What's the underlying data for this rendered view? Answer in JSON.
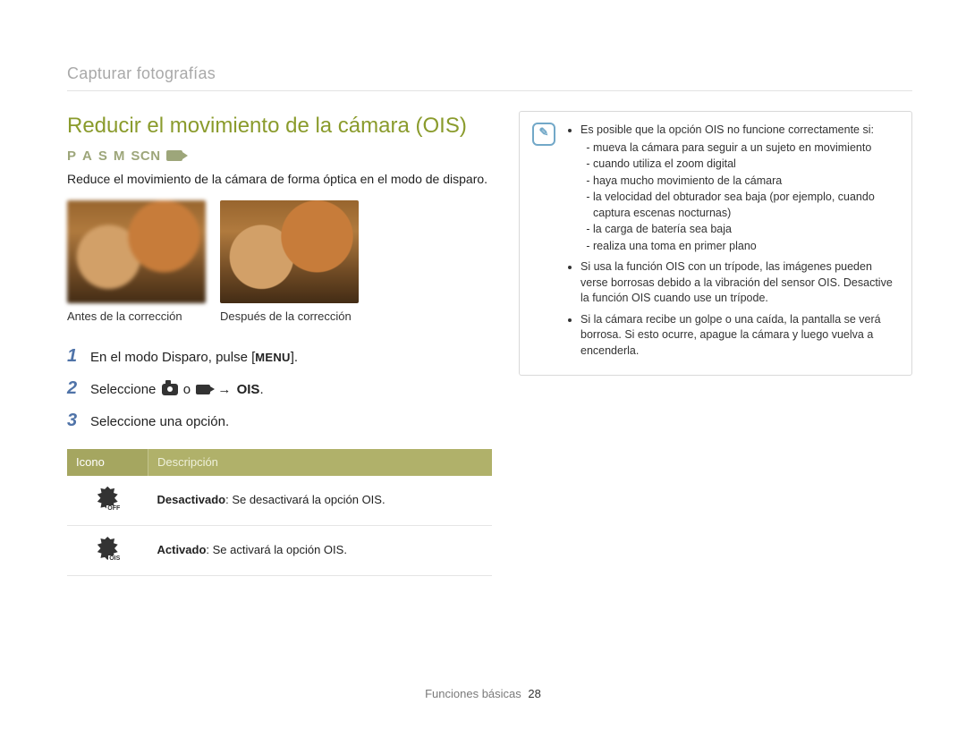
{
  "breadcrumb": "Capturar fotografías",
  "title": "Reducir el movimiento de la cámara (OIS)",
  "modes": {
    "p": "P",
    "a": "A",
    "s": "S",
    "m": "M",
    "scn": "SCN"
  },
  "intro": "Reduce el movimiento de la cámara de forma óptica en el modo de disparo.",
  "captions": {
    "before": "Antes de la corrección",
    "after": "Después de la corrección"
  },
  "steps": [
    {
      "num": "1",
      "prefix": "En el modo Disparo, pulse [",
      "menu": "MENU",
      "suffix": "]."
    },
    {
      "num": "2",
      "prefix": "Seleccione ",
      "connector": " o ",
      "arrow": "→",
      "target": "OIS",
      "suffix": "."
    },
    {
      "num": "3",
      "text": "Seleccione una opción."
    }
  ],
  "table": {
    "head_icon": "Icono",
    "head_desc": "Descripción",
    "rows": [
      {
        "sub": "OFF",
        "label": "Desactivado",
        "desc": ": Se desactivará la opción OIS."
      },
      {
        "sub": "OIS",
        "label": "Activado",
        "desc": ": Se activará la opción OIS."
      }
    ]
  },
  "note": {
    "items": [
      {
        "text": "Es posible que la opción OIS no funcione correctamente si:",
        "sub": [
          "mueva la cámara para seguir a un sujeto en movimiento",
          "cuando utiliza el zoom digital",
          "haya mucho movimiento de la cámara",
          "la velocidad del obturador sea baja (por ejemplo, cuando captura escenas nocturnas)",
          "la carga de batería sea baja",
          "realiza una toma en primer plano"
        ]
      },
      {
        "text": "Si usa la función OIS con un trípode, las imágenes pueden verse borrosas debido a la vibración del sensor OIS. Desactive la función OIS cuando use un trípode."
      },
      {
        "text": "Si la cámara recibe un golpe o una caída, la pantalla se verá borrosa. Si esto ocurre, apague la cámara y luego vuelva a encenderla."
      }
    ]
  },
  "footer": {
    "section": "Funciones básicas",
    "page": "28"
  }
}
